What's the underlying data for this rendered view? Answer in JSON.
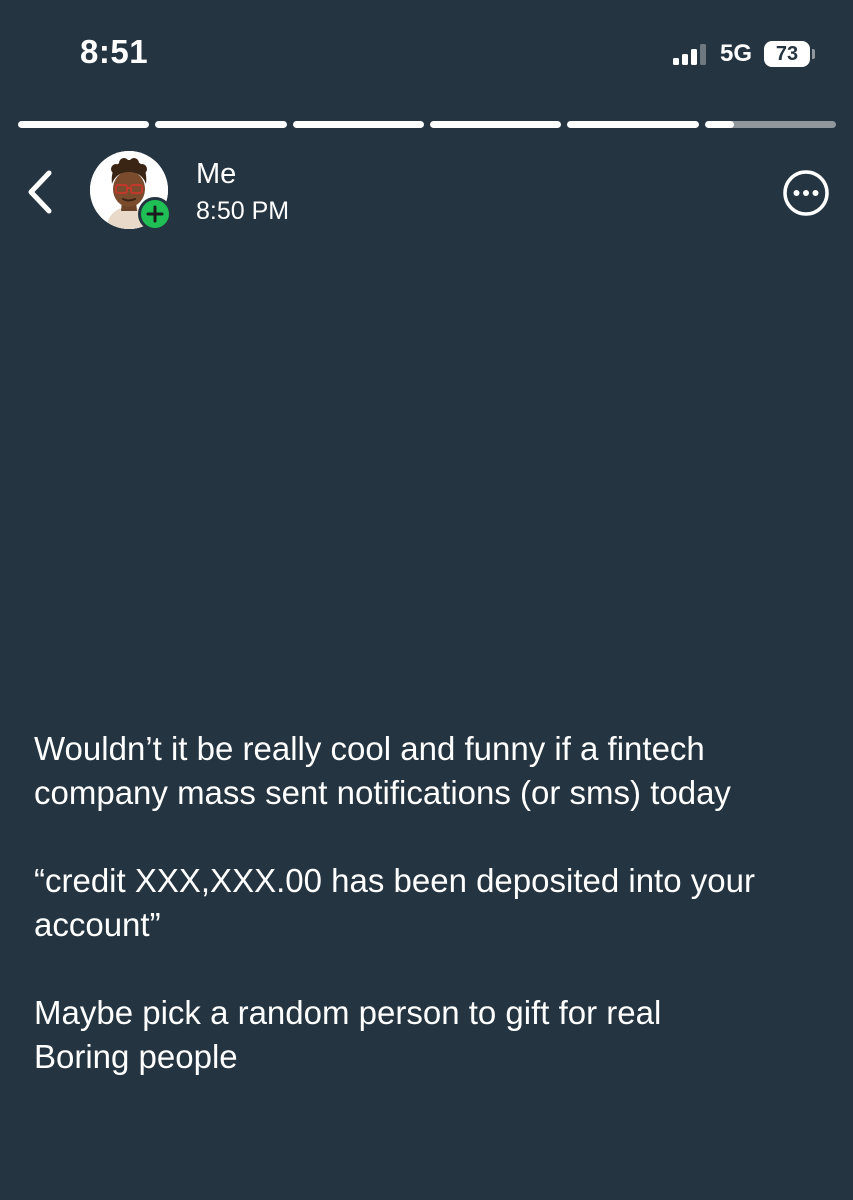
{
  "status_bar": {
    "time": "8:51",
    "network": "5G",
    "battery_level": "73",
    "signal_bars_active": 3,
    "signal_bars_total": 4
  },
  "story": {
    "progress_segments": [
      1,
      1,
      1,
      1,
      1,
      0.22
    ],
    "poster": {
      "name": "Me",
      "time": "8:50 PM",
      "avatar": "memoji-avatar",
      "badge_icon": "plus-icon",
      "badge_color": "#1fbf55"
    },
    "paragraphs": [
      "Wouldn’t it be really cool and funny if a fintech company mass sent notifications (or sms) today",
      "“credit XXX,XXX.00 has been deposited into your account”",
      "Maybe pick a random person to gift for real\nBoring people"
    ]
  },
  "colors": {
    "background": "#243441",
    "text": "#ffffff",
    "progress_track": "#8f979d"
  },
  "icons": {
    "back": "chevron-left-icon",
    "more": "more-options-icon"
  }
}
